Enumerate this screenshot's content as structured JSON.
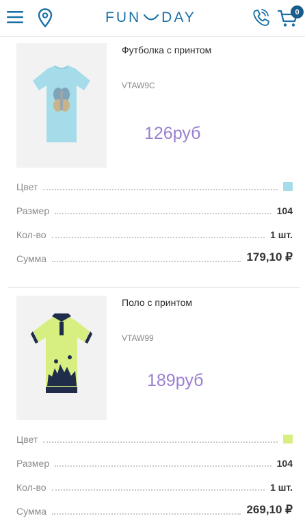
{
  "header": {
    "logo_left": "FUN",
    "logo_right": "DAY",
    "cart_count": "0",
    "icons": [
      "menu-icon",
      "location-pin-icon",
      "phone-icon",
      "cart-icon"
    ]
  },
  "products": [
    {
      "name": "Футболка с принтом",
      "sku": "VTAW9C",
      "price": "126руб",
      "color_label": "Цвет",
      "color_value": "#a6dcea",
      "size_label": "Размер",
      "size_value": "104",
      "qty_label": "Кол-во",
      "qty_value": "1 шт.",
      "sum_label": "Сумма",
      "sum_value": "179,10 ₽"
    },
    {
      "name": "Поло с принтом",
      "sku": "VTAW99",
      "price": "189руб",
      "color_label": "Цвет",
      "color_value": "#d7ef80",
      "size_label": "Размер",
      "size_value": "104",
      "qty_label": "Кол-во",
      "qty_value": "1 шт.",
      "sum_label": "Сумма",
      "sum_value": "269,10 ₽"
    }
  ],
  "colors": {
    "brand": "#1a6fa6",
    "price": "#9b7fd0",
    "badge": "#1a5c8a"
  }
}
